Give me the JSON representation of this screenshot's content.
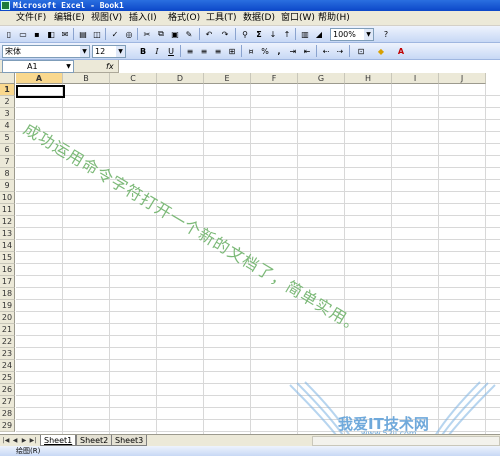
{
  "window": {
    "title": "Microsoft Excel - Book1"
  },
  "menu": [
    "文件(F)",
    "编辑(E)",
    "视图(V)",
    "插入(I)",
    "格式(O)",
    "工具(T)",
    "数据(D)",
    "窗口(W)",
    "帮助(H)"
  ],
  "toolbar": {
    "zoom": "100%",
    "font_name": "宋体",
    "font_size": "12",
    "bold_label": "B",
    "italic_label": "I",
    "underline_label": "U",
    "percent_label": "%",
    "sum_label": "Σ",
    "comma_label": ","
  },
  "formula_bar": {
    "name_box": "A1",
    "fx_label": "fx",
    "content": ""
  },
  "columns": [
    "A",
    "B",
    "C",
    "D",
    "E",
    "F",
    "G",
    "H",
    "I",
    "J"
  ],
  "rows": [
    "1",
    "2",
    "3",
    "4",
    "5",
    "6",
    "7",
    "8",
    "9",
    "10",
    "11",
    "12",
    "13",
    "14",
    "15",
    "16",
    "17",
    "18",
    "19",
    "20",
    "21",
    "22",
    "23",
    "24",
    "25",
    "26",
    "27",
    "28",
    "29"
  ],
  "overlay_text": "成功运用命令字符打开一个新的文档了，简单实用。",
  "watermark": {
    "title": "我爱IT技术网",
    "url": "www.52ij.com"
  },
  "sheet_tabs": [
    "Sheet1",
    "Sheet2",
    "Sheet3"
  ],
  "draw_toolbar_label": "绘图(R)",
  "colors": {
    "title_bar": "#0c47c8",
    "overlay_text": "#7cb978",
    "active_header": "#f9d88e"
  }
}
